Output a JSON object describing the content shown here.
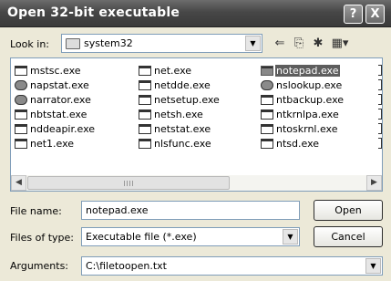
{
  "window": {
    "title": "Open 32-bit executable"
  },
  "titlebar_buttons": {
    "help": "?",
    "close": "X"
  },
  "look_in": {
    "label": "Look in:",
    "value": "system32"
  },
  "files": [
    {
      "name": "mstsc.exe",
      "icon": "remote-desktop-icon"
    },
    {
      "name": "napstat.exe",
      "icon": "shield-check-icon"
    },
    {
      "name": "narrator.exe",
      "icon": "narrator-icon"
    },
    {
      "name": "nbtstat.exe",
      "icon": "console-icon"
    },
    {
      "name": "nddeapir.exe",
      "icon": "console-icon"
    },
    {
      "name": "net1.exe",
      "icon": "console-icon"
    },
    {
      "name": "net.exe",
      "icon": "console-icon"
    },
    {
      "name": "netdde.exe",
      "icon": "console-icon"
    },
    {
      "name": "netsetup.exe",
      "icon": "setup-icon"
    },
    {
      "name": "netsh.exe",
      "icon": "console-icon"
    },
    {
      "name": "netstat.exe",
      "icon": "console-icon"
    },
    {
      "name": "nlsfunc.exe",
      "icon": "console-icon"
    },
    {
      "name": "notepad.exe",
      "icon": "notepad-icon",
      "selected": true
    },
    {
      "name": "nslookup.exe",
      "icon": "network-user-icon"
    },
    {
      "name": "ntbackup.exe",
      "icon": "backup-icon"
    },
    {
      "name": "ntkrnlpa.exe",
      "icon": "console-icon"
    },
    {
      "name": "ntoskrnl.exe",
      "icon": "console-icon"
    },
    {
      "name": "ntsd.exe",
      "icon": "debugger-icon"
    }
  ],
  "file_name": {
    "label": "File name:",
    "value": "notepad.exe"
  },
  "file_type": {
    "label": "Files of type:",
    "value": "Executable file (*.exe)"
  },
  "arguments": {
    "label": "Arguments:",
    "value": "C:\\filetoopen.txt"
  },
  "buttons": {
    "open": "Open",
    "cancel": "Cancel"
  }
}
